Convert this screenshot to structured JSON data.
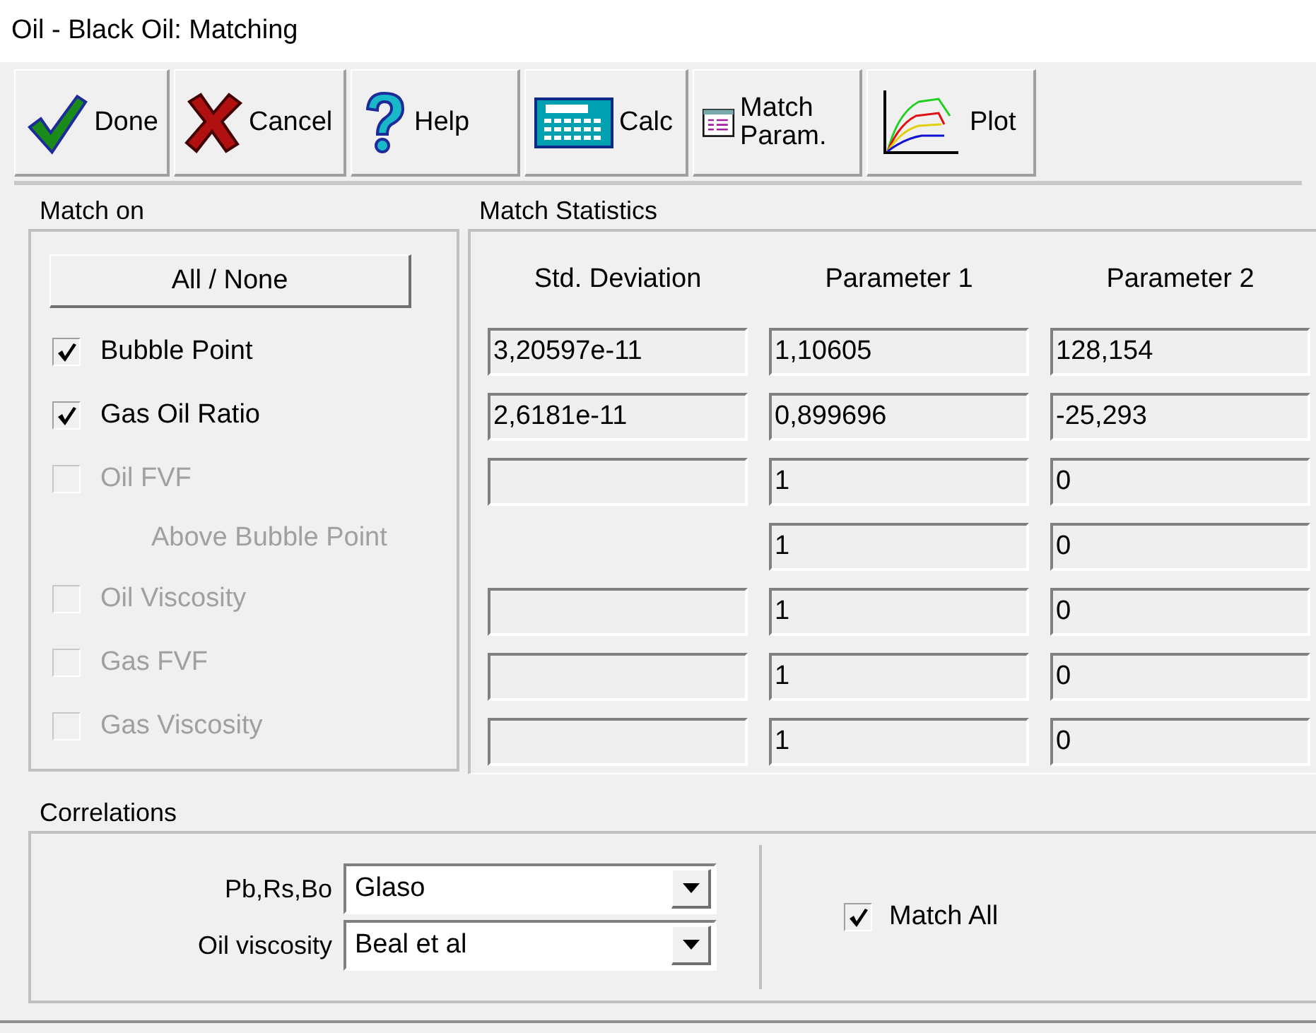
{
  "window": {
    "title": "Oil - Black Oil: Matching"
  },
  "toolbar": [
    {
      "label": "Done",
      "kind": "done"
    },
    {
      "label": "Cancel",
      "kind": "cancel"
    },
    {
      "label": "Help",
      "kind": "help"
    },
    {
      "label": "Calc",
      "kind": "calc"
    },
    {
      "label": "Match Param.",
      "kind": "params"
    },
    {
      "label": "Plot",
      "kind": "plot"
    }
  ],
  "match_on": {
    "title": "Match on",
    "all_none_button": "All / None",
    "items": [
      {
        "kind": "checkbox",
        "label": "Bubble Point",
        "checked": true,
        "disabled": false
      },
      {
        "kind": "checkbox",
        "label": "Gas Oil Ratio",
        "checked": true,
        "disabled": false
      },
      {
        "kind": "checkbox",
        "label": "Oil FVF",
        "checked": false,
        "disabled": true
      },
      {
        "kind": "sublabel",
        "label": "Above Bubble Point",
        "disabled": true
      },
      {
        "kind": "checkbox",
        "label": "Oil Viscosity",
        "checked": false,
        "disabled": true
      },
      {
        "kind": "checkbox",
        "label": "Gas FVF",
        "checked": false,
        "disabled": true
      },
      {
        "kind": "checkbox",
        "label": "Gas Viscosity",
        "checked": false,
        "disabled": true
      }
    ]
  },
  "match_statistics": {
    "title": "Match Statistics",
    "columns": [
      "Std. Deviation",
      "Parameter 1",
      "Parameter 2"
    ],
    "rows": [
      {
        "kind": "full",
        "std_deviation": "3,20597e-11",
        "parameter_1": "1,10605",
        "parameter_2": "128,154"
      },
      {
        "kind": "full",
        "std_deviation": "2,6181e-11",
        "parameter_1": "0,899696",
        "parameter_2": "-25,293"
      },
      {
        "kind": "full",
        "parameter_1": "1",
        "parameter_2": "0"
      },
      {
        "kind": "params_only",
        "parameter_1": "1",
        "parameter_2": "0"
      },
      {
        "kind": "full",
        "parameter_1": "1",
        "parameter_2": "0"
      },
      {
        "kind": "full",
        "parameter_1": "1",
        "parameter_2": "0"
      },
      {
        "kind": "full",
        "parameter_1": "1",
        "parameter_2": "0"
      }
    ]
  },
  "correlations": {
    "title": "Correlations",
    "fields": [
      {
        "label": "Pb,Rs,Bo",
        "value": "Glaso"
      },
      {
        "label": "Oil viscosity",
        "value": "Beal et al"
      }
    ],
    "match_all": {
      "label": "Match All",
      "checked": true
    }
  }
}
